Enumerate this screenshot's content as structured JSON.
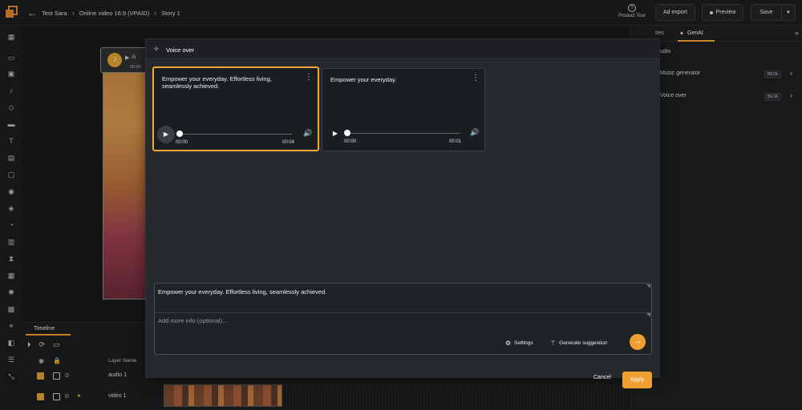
{
  "header": {
    "breadcrumbs": [
      "Test Sara",
      "Online video 16:9 (VPAID)",
      "Story 1"
    ],
    "product_tour": "Product Tour",
    "ad_export": "Ad export",
    "preview": "Preview",
    "save": "Save"
  },
  "canvas": {
    "audio_time": "00:00"
  },
  "right_panel": {
    "tab_properties": "ties",
    "tab_genai": "GenAI",
    "section": "udio",
    "items": [
      {
        "label": "Music generator",
        "badge": "BETA"
      },
      {
        "label": "Voice over",
        "badge": "BETA"
      }
    ]
  },
  "timeline": {
    "tab": "Timeline",
    "col_layer_name": "Layer Name",
    "layers": [
      {
        "name": "audio 1"
      },
      {
        "name": "video 1"
      }
    ]
  },
  "modal": {
    "title": "Voice over",
    "cards": [
      {
        "text": "Empower your everyday. Effortless living, seamlessly achieved.",
        "current": "00:00",
        "duration": "00:04",
        "selected": true
      },
      {
        "text": "Empower your everyday.",
        "current": "00:00",
        "duration": "00:01",
        "selected": false
      }
    ],
    "prompt_text": "Empower your everyday. Effortless living, seamlessly achieved.",
    "extra_placeholder": "Add more info (optional)...",
    "settings": "Settings",
    "generate": "Generate suggestion",
    "cancel": "Cancel",
    "apply": "Apply"
  },
  "colors": {
    "accent": "#f0a030",
    "background": "#1e1f21",
    "modal": "#26292d"
  }
}
